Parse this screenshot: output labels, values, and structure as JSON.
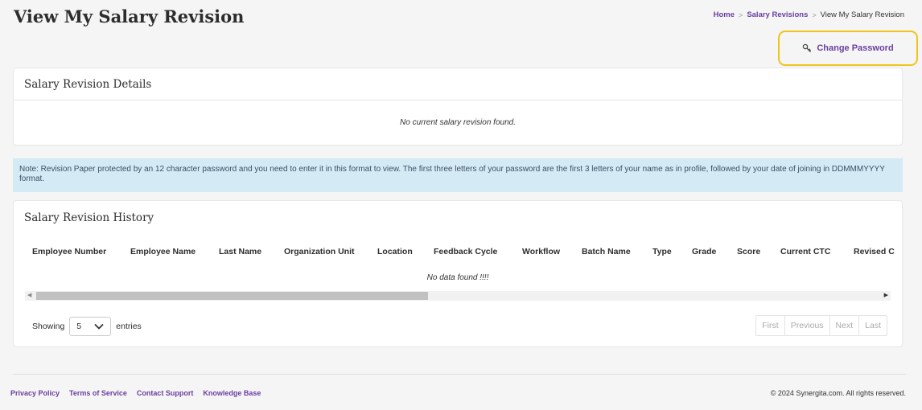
{
  "page": {
    "title": "View My Salary Revision"
  },
  "breadcrumb": {
    "home": "Home",
    "salary_revisions": "Salary Revisions",
    "current": "View My Salary Revision",
    "separator": ">"
  },
  "actions": {
    "change_password": "Change Password",
    "icon": "key-icon"
  },
  "details_card": {
    "title": "Salary Revision Details",
    "empty_message": "No current salary revision found."
  },
  "note": {
    "text": "Note: Revision Paper protected by an 12 character password and you need to enter it in this format to view. The first three letters of your password are the first 3 letters of your name as in profile, followed by your date of joining in DDMMMYYYY format."
  },
  "history_card": {
    "title": "Salary Revision History",
    "columns": [
      "Employee Number",
      "Employee Name",
      "Last Name",
      "Organization Unit",
      "Location",
      "Feedback Cycle",
      "Workflow",
      "Batch Name",
      "Type",
      "Grade",
      "Score",
      "Current CTC",
      "Revised C"
    ],
    "empty_message": "No data found !!!!",
    "showing_label": "Showing",
    "entries_value": "5",
    "entries_label": "entries",
    "pagination": {
      "first": "First",
      "previous": "Previous",
      "next": "Next",
      "last": "Last"
    }
  },
  "footer": {
    "links": [
      "Privacy Policy",
      "Terms of Service",
      "Contact Support",
      "Knowledge Base"
    ],
    "copyright": "© 2024 Synergita.com. All rights reserved."
  },
  "colors": {
    "accent": "#6b3fa0",
    "highlight_border": "#f0c419",
    "note_bg": "#d4eaf5",
    "page_bg": "#f5f5f5"
  }
}
